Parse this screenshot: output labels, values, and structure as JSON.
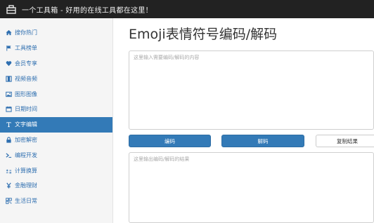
{
  "topbar": {
    "title": "一个工具箱 - 好用的在线工具都在这里！"
  },
  "sidebar": {
    "items": [
      {
        "label": "搜你热门",
        "icon": "home-icon",
        "active": false
      },
      {
        "label": "工具榜单",
        "icon": "flag-icon",
        "active": false
      },
      {
        "label": "会员专享",
        "icon": "heart-icon",
        "active": false
      },
      {
        "label": "视频音频",
        "icon": "film-icon",
        "active": false
      },
      {
        "label": "图形图像",
        "icon": "image-icon",
        "active": false
      },
      {
        "label": "日期时间",
        "icon": "calendar-icon",
        "active": false
      },
      {
        "label": "文字编辑",
        "icon": "text-icon",
        "active": true
      },
      {
        "label": "加密解密",
        "icon": "lock-icon",
        "active": false
      },
      {
        "label": "编程开发",
        "icon": "terminal-icon",
        "active": false
      },
      {
        "label": "计算换算",
        "icon": "calculator-icon",
        "active": false
      },
      {
        "label": "金融理财",
        "icon": "yen-icon",
        "active": false
      },
      {
        "label": "生活日常",
        "icon": "qrcode-icon",
        "active": false
      }
    ]
  },
  "main": {
    "title": "Emoji表情符号编码/解码",
    "input_placeholder": "这里输入需要编码/解码的内容",
    "output_placeholder": "这里输出编码/解码的结果",
    "encode_label": "编码",
    "decode_label": "解码",
    "copy_label": "复制结果"
  },
  "colors": {
    "topbar_bg": "#222222",
    "accent": "#337ab7",
    "sidebar_bg": "#f5f5f5",
    "link": "#2f6fb0"
  }
}
